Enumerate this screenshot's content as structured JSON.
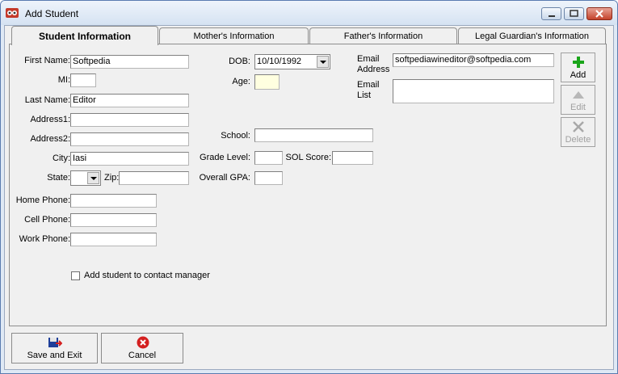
{
  "window": {
    "title": "Add Student"
  },
  "tabs": [
    {
      "label": "Student Information",
      "active": true
    },
    {
      "label": "Mother's Information"
    },
    {
      "label": "Father's Information"
    },
    {
      "label": "Legal Guardian's Information"
    }
  ],
  "student": {
    "first_name_label": "First Name:",
    "first_name": "Softpedia",
    "mi_label": "MI:",
    "mi": "",
    "last_name_label": "Last Name:",
    "last_name": "Editor",
    "address1_label": "Address1:",
    "address1": "",
    "address2_label": "Address2:",
    "address2": "",
    "city_label": "City:",
    "city": "Iasi",
    "state_label": "State:",
    "state": "",
    "zip_label": "Zip:",
    "zip": "",
    "home_phone_label": "Home Phone:",
    "home_phone": "",
    "cell_phone_label": "Cell Phone:",
    "cell_phone": "",
    "work_phone_label": "Work Phone:",
    "work_phone": "",
    "dob_label": "DOB:",
    "dob": "10/10/1992",
    "age_label": "Age:",
    "age": "",
    "school_label": "School:",
    "school": "",
    "grade_level_label": "Grade Level:",
    "grade_level": "",
    "sol_score_label": "SOL Score:",
    "sol_score": "",
    "gpa_label": "Overall GPA:",
    "gpa": "",
    "email_label_1": "Email",
    "email_label_2": "Address",
    "email": "softpediawineditor@softpedia.com",
    "email_list_label_1": "Email",
    "email_list_label_2": "List",
    "contact_manager_label": "Add student to contact manager",
    "contact_manager_checked": false
  },
  "side_buttons": {
    "add": "Add",
    "edit": "Edit",
    "delete": "Delete"
  },
  "footer": {
    "save_exit": "Save and Exit",
    "cancel": "Cancel"
  },
  "colors": {
    "accent_green": "#1aa51a",
    "cancel_red": "#d42020",
    "titlebar": "#dfe9f5"
  }
}
